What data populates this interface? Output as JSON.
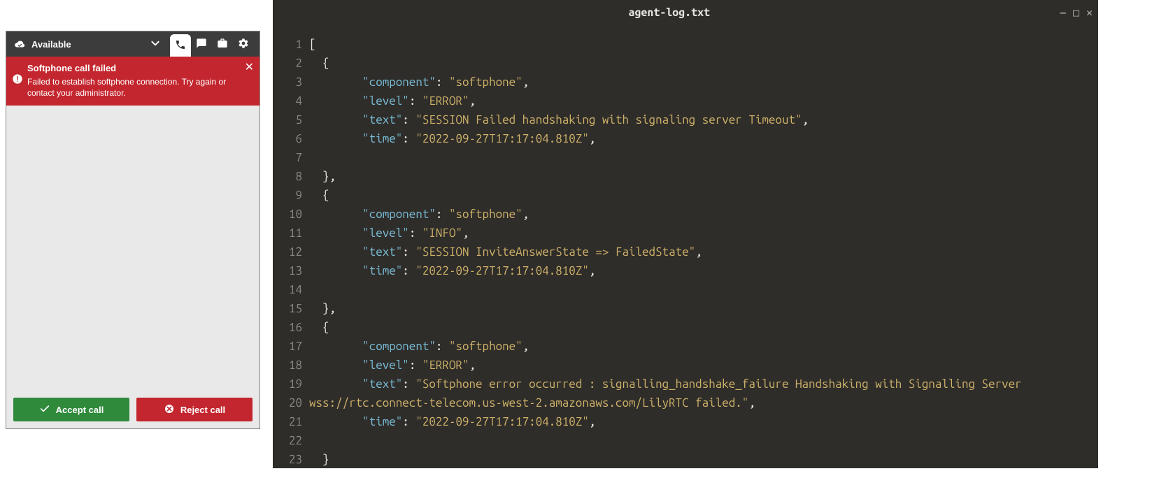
{
  "softphone": {
    "status_label": "Available",
    "error": {
      "title": "Softphone call failed",
      "body": "Failed to establish softphone connection. Try again or contact your administrator."
    },
    "accept_label": "Accept call",
    "reject_label": "Reject call"
  },
  "editor": {
    "filename": "agent-log.txt",
    "lines": [
      {
        "n": 1,
        "tokens": [
          {
            "t": "[",
            "c": "punc"
          }
        ]
      },
      {
        "n": 2,
        "tokens": [
          {
            "t": "  {",
            "c": "punc"
          }
        ]
      },
      {
        "n": 3,
        "tokens": [
          {
            "t": "        ",
            "c": "punc"
          },
          {
            "t": "\"component\"",
            "c": "key"
          },
          {
            "t": ": ",
            "c": "punc"
          },
          {
            "t": "\"softphone\"",
            "c": "str"
          },
          {
            "t": ",",
            "c": "punc"
          }
        ]
      },
      {
        "n": 4,
        "tokens": [
          {
            "t": "        ",
            "c": "punc"
          },
          {
            "t": "\"level\"",
            "c": "key"
          },
          {
            "t": ": ",
            "c": "punc"
          },
          {
            "t": "\"ERROR\"",
            "c": "str"
          },
          {
            "t": ",",
            "c": "punc"
          }
        ]
      },
      {
        "n": 5,
        "tokens": [
          {
            "t": "        ",
            "c": "punc"
          },
          {
            "t": "\"text\"",
            "c": "key"
          },
          {
            "t": ": ",
            "c": "punc"
          },
          {
            "t": "\"SESSION Failed handshaking with signaling server Timeout\"",
            "c": "str"
          },
          {
            "t": ",",
            "c": "punc"
          }
        ]
      },
      {
        "n": 6,
        "tokens": [
          {
            "t": "        ",
            "c": "punc"
          },
          {
            "t": "\"time\"",
            "c": "key"
          },
          {
            "t": ": ",
            "c": "punc"
          },
          {
            "t": "\"2022-09-27T17:17:04.810Z\"",
            "c": "str"
          },
          {
            "t": ",",
            "c": "punc"
          }
        ]
      },
      {
        "n": 7,
        "tokens": []
      },
      {
        "n": 8,
        "tokens": [
          {
            "t": "  },",
            "c": "punc"
          }
        ]
      },
      {
        "n": 9,
        "tokens": [
          {
            "t": "  {",
            "c": "punc"
          }
        ]
      },
      {
        "n": 10,
        "tokens": [
          {
            "t": "        ",
            "c": "punc"
          },
          {
            "t": "\"component\"",
            "c": "key"
          },
          {
            "t": ": ",
            "c": "punc"
          },
          {
            "t": "\"softphone\"",
            "c": "str"
          },
          {
            "t": ",",
            "c": "punc"
          }
        ]
      },
      {
        "n": 11,
        "tokens": [
          {
            "t": "        ",
            "c": "punc"
          },
          {
            "t": "\"level\"",
            "c": "key"
          },
          {
            "t": ": ",
            "c": "punc"
          },
          {
            "t": "\"INFO\"",
            "c": "str"
          },
          {
            "t": ",",
            "c": "punc"
          }
        ]
      },
      {
        "n": 12,
        "tokens": [
          {
            "t": "        ",
            "c": "punc"
          },
          {
            "t": "\"text\"",
            "c": "key"
          },
          {
            "t": ": ",
            "c": "punc"
          },
          {
            "t": "\"SESSION InviteAnswerState => FailedState\"",
            "c": "str"
          },
          {
            "t": ",",
            "c": "punc"
          }
        ]
      },
      {
        "n": 13,
        "tokens": [
          {
            "t": "        ",
            "c": "punc"
          },
          {
            "t": "\"time\"",
            "c": "key"
          },
          {
            "t": ": ",
            "c": "punc"
          },
          {
            "t": "\"2022-09-27T17:17:04.810Z\"",
            "c": "str"
          },
          {
            "t": ",",
            "c": "punc"
          }
        ]
      },
      {
        "n": 14,
        "tokens": []
      },
      {
        "n": 15,
        "tokens": [
          {
            "t": "  },",
            "c": "punc"
          }
        ]
      },
      {
        "n": 16,
        "tokens": [
          {
            "t": "  {",
            "c": "punc"
          }
        ]
      },
      {
        "n": 17,
        "tokens": [
          {
            "t": "        ",
            "c": "punc"
          },
          {
            "t": "\"component\"",
            "c": "key"
          },
          {
            "t": ": ",
            "c": "punc"
          },
          {
            "t": "\"softphone\"",
            "c": "str"
          },
          {
            "t": ",",
            "c": "punc"
          }
        ]
      },
      {
        "n": 18,
        "tokens": [
          {
            "t": "        ",
            "c": "punc"
          },
          {
            "t": "\"level\"",
            "c": "key"
          },
          {
            "t": ": ",
            "c": "punc"
          },
          {
            "t": "\"ERROR\"",
            "c": "str"
          },
          {
            "t": ",",
            "c": "punc"
          }
        ]
      },
      {
        "n": 19,
        "tokens": [
          {
            "t": "        ",
            "c": "punc"
          },
          {
            "t": "\"text\"",
            "c": "key"
          },
          {
            "t": ": ",
            "c": "punc"
          },
          {
            "t": "\"Softphone error occurred : signalling_handshake_failure Handshaking with Signalling Server \nwss://rtc.connect-telecom.us-west-2.amazonaws.com/LilyRTC failed.\"",
            "c": "str"
          },
          {
            "t": ",",
            "c": "punc"
          }
        ]
      },
      {
        "n": 20,
        "tokens": [
          {
            "t": "        ",
            "c": "punc"
          },
          {
            "t": "\"time\"",
            "c": "key"
          },
          {
            "t": ": ",
            "c": "punc"
          },
          {
            "t": "\"2022-09-27T17:17:04.810Z\"",
            "c": "str"
          },
          {
            "t": ",",
            "c": "punc"
          }
        ]
      },
      {
        "n": 21,
        "tokens": []
      },
      {
        "n": 22,
        "tokens": [
          {
            "t": "  }",
            "c": "punc"
          }
        ]
      },
      {
        "n": 23,
        "tokens": [
          {
            "t": "]",
            "c": "punc"
          }
        ]
      }
    ]
  }
}
